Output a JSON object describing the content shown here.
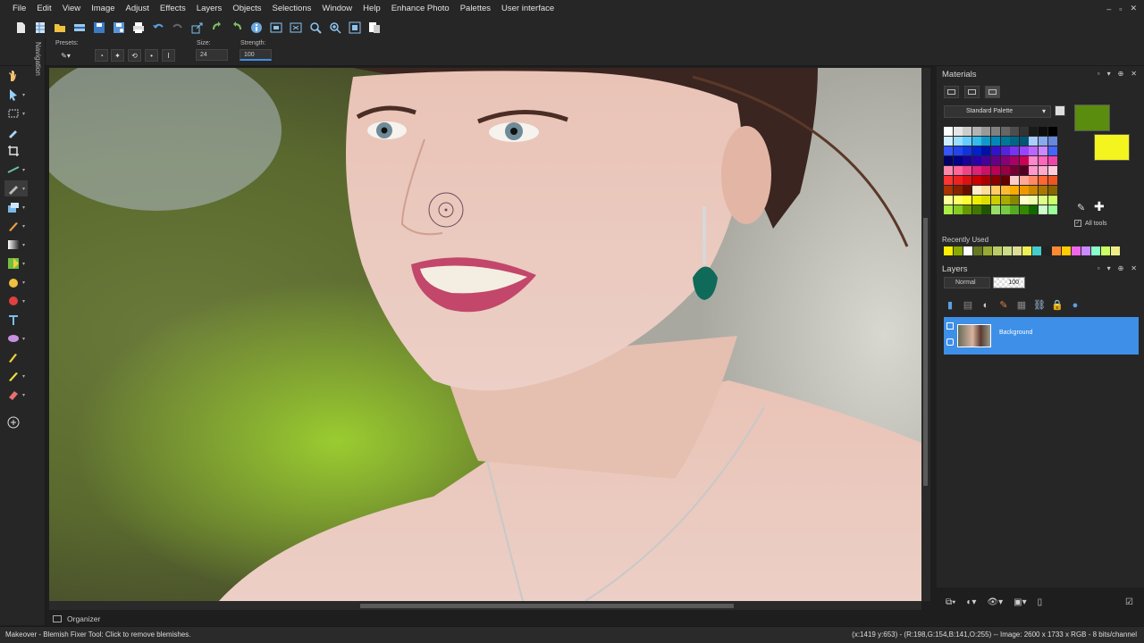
{
  "menu": [
    {
      "label": "File",
      "u": "F"
    },
    {
      "label": "Edit",
      "u": "E"
    },
    {
      "label": "View",
      "u": "V"
    },
    {
      "label": "Image",
      "u": "I"
    },
    {
      "label": "Adjust",
      "u": "A"
    },
    {
      "label": "Effects",
      "u": "f"
    },
    {
      "label": "Layers",
      "u": "L"
    },
    {
      "label": "Objects",
      "u": "O"
    },
    {
      "label": "Selections",
      "u": "S"
    },
    {
      "label": "Window",
      "u": "W"
    },
    {
      "label": "Help",
      "u": "H"
    },
    {
      "label": "Enhance Photo",
      "u": ""
    },
    {
      "label": "Palettes",
      "u": ""
    },
    {
      "label": "User interface",
      "u": ""
    }
  ],
  "window_controls": [
    "–",
    "▫",
    "✕"
  ],
  "tool_options": {
    "presets_label": "Presets:",
    "size_label": "Size:",
    "size_value": "24",
    "strength_label": "Strength:",
    "strength_value": "100"
  },
  "navigation_label": "Navigation",
  "organizer_label": "Organizer",
  "status": {
    "left": "Makeover - Blemish Fixer Tool: Click to remove blemishes.",
    "right": "(x:1419 y:653) - (R:198,G:154,B:141,O:255) -- Image:  2600 x 1733 x RGB - 8 bits/channel"
  },
  "materials": {
    "title": "Materials",
    "palette_name": "Standard Palette",
    "all_tools_label": "All tools",
    "recently_used_label": "Recently Used",
    "foreground_color": "#5a8c0e",
    "background_color": "#f4f41e",
    "swatch_rows": [
      [
        "#ffffff",
        "#e6e6e6",
        "#cccccc",
        "#b3b3b3",
        "#999999",
        "#808080",
        "#666666",
        "#4d4d4d",
        "#333333",
        "#1a1a1a",
        "#0d0d0d",
        "#000000"
      ],
      [
        "#cceeff",
        "#99ddff",
        "#66ccff",
        "#33bbee",
        "#1199cc",
        "#0088bb",
        "#007799",
        "#006688",
        "#005577",
        "#aaccff",
        "#88aaee",
        "#6688dd"
      ],
      [
        "#3355ff",
        "#2244ee",
        "#1133dd",
        "#0022cc",
        "#0011aa",
        "#3311cc",
        "#5522dd",
        "#7733ee",
        "#9944ff",
        "#bb66ff",
        "#cc88ff",
        "#4466ff"
      ],
      [
        "#000066",
        "#000088",
        "#1a0099",
        "#2a00aa",
        "#440099",
        "#660088",
        "#880077",
        "#aa0066",
        "#cc0055",
        "#ff88cc",
        "#ff66bb",
        "#ee44aa"
      ],
      [
        "#ff88aa",
        "#ff6699",
        "#ee4488",
        "#dd2277",
        "#cc1166",
        "#bb0055",
        "#990044",
        "#770033",
        "#550022",
        "#ff99cc",
        "#ffaacc",
        "#ffccdd"
      ],
      [
        "#ff3333",
        "#ee2222",
        "#dd1111",
        "#cc0000",
        "#aa0000",
        "#880000",
        "#660000",
        "#ffcccc",
        "#ffaa99",
        "#ff8866",
        "#ff6633",
        "#ee5522"
      ],
      [
        "#aa3300",
        "#882200",
        "#661100",
        "#ffeecc",
        "#ffdd99",
        "#ffcc66",
        "#ffbb33",
        "#ffaa00",
        "#ee9900",
        "#cc8800",
        "#aa7700",
        "#886600"
      ],
      [
        "#ffff99",
        "#ffff66",
        "#ffff33",
        "#eeee00",
        "#dddd00",
        "#cccc00",
        "#aaaa00",
        "#888800",
        "#ffffcc",
        "#eeffaa",
        "#ddff88",
        "#ccff66"
      ],
      [
        "#aaee44",
        "#88cc22",
        "#669900",
        "#447700",
        "#225500",
        "#99dd66",
        "#77cc44",
        "#55aa22",
        "#338800",
        "#116600",
        "#ccffcc",
        "#99ff99"
      ]
    ],
    "recent_colors": [
      "#ffee00",
      "#88aa00",
      "#ffffff",
      "#667722",
      "#99aa33",
      "#bbcc66",
      "#ccdd88",
      "#dddd99",
      "#eeee55",
      "#44cccc",
      "#222222",
      "#ff8833",
      "#ffcc00",
      "#ee66ee",
      "#cc88ff",
      "#88ffcc",
      "#ccff66",
      "#eeee88"
    ]
  },
  "layers": {
    "title": "Layers",
    "blend_mode": "Normal",
    "opacity": "100",
    "layer_name": "Background"
  }
}
